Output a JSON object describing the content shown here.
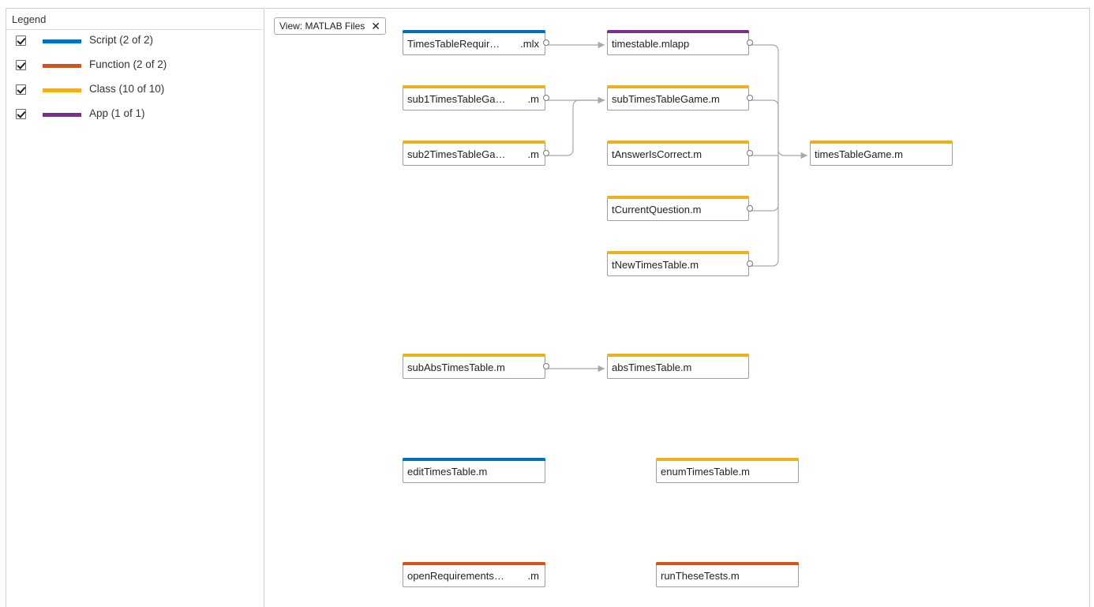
{
  "colors": {
    "script": "#0072bd",
    "function": "#d95319",
    "class": "#edb120",
    "app": "#7e2f8e",
    "edge": "#a8a8a8"
  },
  "legend": {
    "title": "Legend",
    "items": [
      {
        "label": "Script (2 of 2)",
        "checked": true,
        "type": "script"
      },
      {
        "label": "Function (2 of 2)",
        "checked": true,
        "type": "function"
      },
      {
        "label": "Class (10 of 10)",
        "checked": true,
        "type": "class"
      },
      {
        "label": "App (1 of 1)",
        "checked": true,
        "type": "app"
      }
    ]
  },
  "view_filter": {
    "label": "View: MATLAB Files",
    "close_icon": "close-icon"
  },
  "nodes": [
    {
      "id": "n1",
      "name": "TimesTableRequir…",
      "ext": ".mlx",
      "type": "script"
    },
    {
      "id": "n2",
      "name": "sub1TimesTableGa…",
      "ext": ".m",
      "type": "class"
    },
    {
      "id": "n3",
      "name": "sub2TimesTableGa…",
      "ext": ".m",
      "type": "class"
    },
    {
      "id": "n4",
      "name": "timestable.mlapp",
      "ext": "",
      "type": "app"
    },
    {
      "id": "n5",
      "name": "subTimesTableGame.m",
      "ext": "",
      "type": "class"
    },
    {
      "id": "n6",
      "name": "tAnswerIsCorrect.m",
      "ext": "",
      "type": "class"
    },
    {
      "id": "n7",
      "name": "tCurrentQuestion.m",
      "ext": "",
      "type": "class"
    },
    {
      "id": "n8",
      "name": "tNewTimesTable.m",
      "ext": "",
      "type": "class"
    },
    {
      "id": "n9",
      "name": "timesTableGame.m",
      "ext": "",
      "type": "class"
    },
    {
      "id": "n10",
      "name": "subAbsTimesTable.m",
      "ext": "",
      "type": "class"
    },
    {
      "id": "n11",
      "name": "absTimesTable.m",
      "ext": "",
      "type": "class"
    },
    {
      "id": "n12",
      "name": "editTimesTable.m",
      "ext": "",
      "type": "script"
    },
    {
      "id": "n13",
      "name": "enumTimesTable.m",
      "ext": "",
      "type": "class"
    },
    {
      "id": "n14",
      "name": "openRequirements…",
      "ext": ".m",
      "type": "function"
    },
    {
      "id": "n15",
      "name": "runTheseTests.m",
      "ext": "",
      "type": "function"
    }
  ],
  "edges": [
    {
      "from": "n1",
      "to": "n4"
    },
    {
      "from": "n2",
      "to": "n5"
    },
    {
      "from": "n3",
      "to": "n5"
    },
    {
      "from": "n4",
      "to": "n9"
    },
    {
      "from": "n5",
      "to": "n9"
    },
    {
      "from": "n6",
      "to": "n9"
    },
    {
      "from": "n7",
      "to": "n9"
    },
    {
      "from": "n8",
      "to": "n9"
    },
    {
      "from": "n10",
      "to": "n11"
    }
  ]
}
